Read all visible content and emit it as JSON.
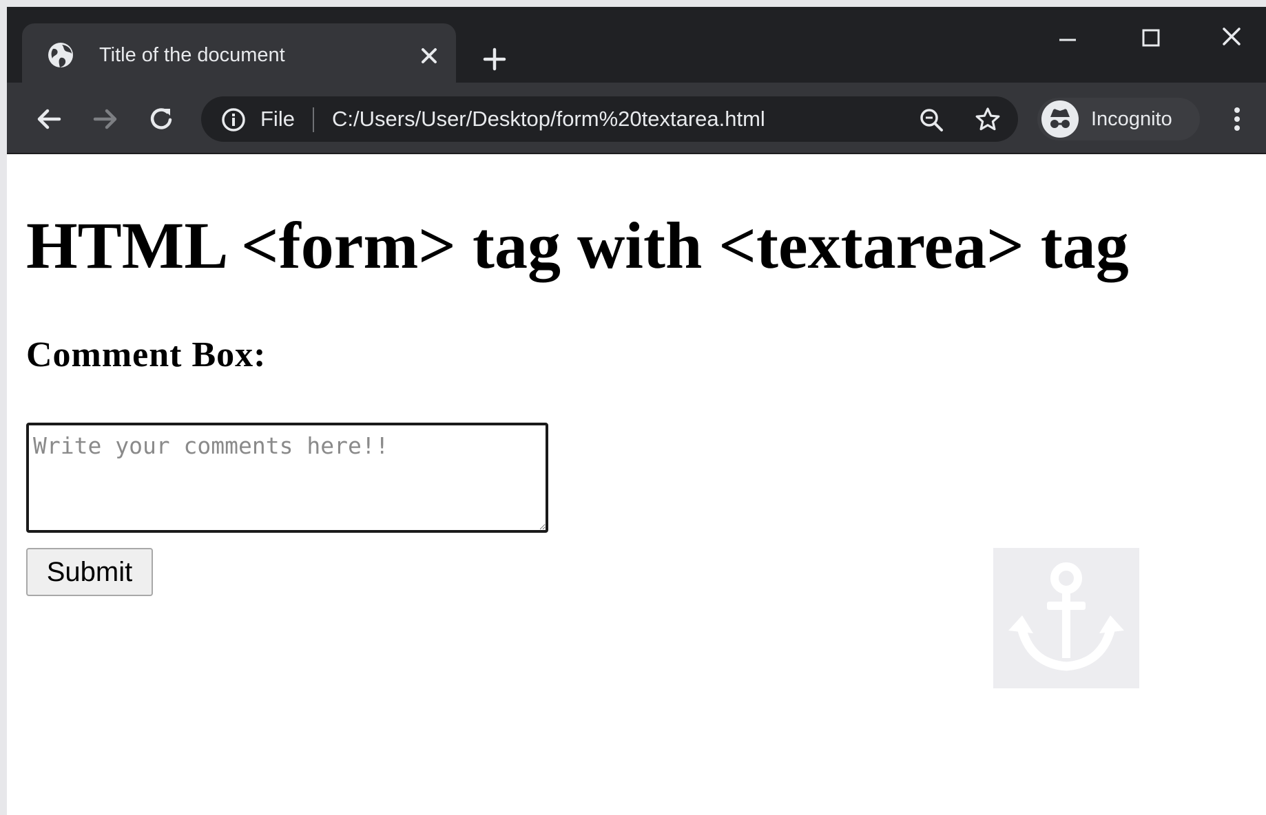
{
  "browser": {
    "tab": {
      "title": "Title of the document",
      "favicon": "globe-icon"
    },
    "address_bar": {
      "security_label": "File",
      "url": "C:/Users/User/Desktop/form%20textarea.html"
    },
    "profile": {
      "label": "Incognito"
    },
    "colors": {
      "tab_strip": "#202124",
      "toolbar": "#35363a",
      "omnibox": "#202124",
      "text": "#e8eaed"
    }
  },
  "page": {
    "heading": "HTML <form> tag with <textarea> tag",
    "comment_label": "Comment Box:",
    "textarea": {
      "placeholder": "Write your comments here!!",
      "value": ""
    },
    "submit_label": "Submit",
    "watermark_icon": "anchor-icon"
  }
}
